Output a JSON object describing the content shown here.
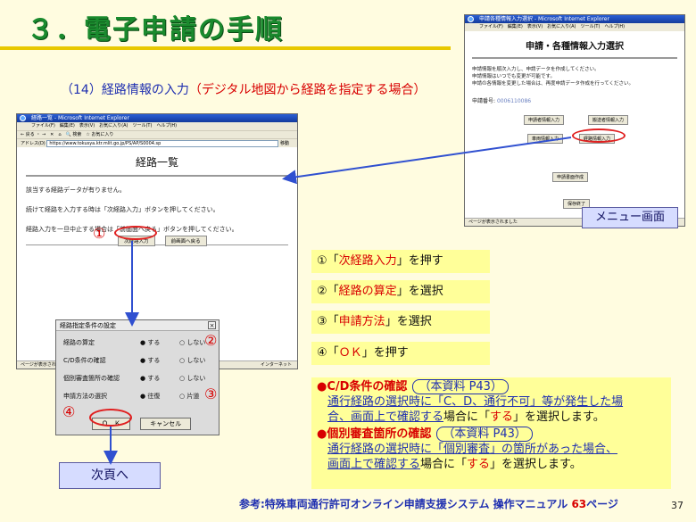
{
  "title": "３．電子申請の手順",
  "subtitle": {
    "main": "（14）経路情報の入力",
    "note": "（デジタル地図から経路を指定する場合）"
  },
  "route_window": {
    "title": "経路一覧 - Microsoft Internet Explorer",
    "menu": "ファイル(F)　編集(E)　表示(V)　お気に入り(A)　ツール(T)　ヘルプ(H)",
    "toolbar": "← 戻る ・ →　✕　⌂　🔍 検索　☆ お気に入り",
    "address_label": "アドレス(D)",
    "url": "https://www.tokusya.ktr.mlit.go.jp/PS/AP/S0004.sp",
    "go_label": "移動",
    "heading": "経路一覧",
    "lines": [
      "該当する経路データが有りません。",
      "続けて経路を入力する時は「次経路入力」ボタンを押してください。",
      "経路入力を一旦中止する場合は「前画面へ戻る」ボタンを押してください。"
    ],
    "buttons": {
      "next_route": "次経路入力",
      "back": "前画面へ戻る"
    },
    "status_left": "ページが表示されました",
    "status_right": "インターネット"
  },
  "dialog": {
    "title": "経路指定条件の設定",
    "rows": [
      {
        "label": "経路の算定",
        "yes": "● する",
        "no": "○ しない"
      },
      {
        "label": "C/D条件の確認",
        "yes": "● する",
        "no": "○ しない"
      },
      {
        "label": "個別審査箇所の確認",
        "yes": "● する",
        "no": "○ しない"
      },
      {
        "label": "申請方法の選択",
        "yes": "● 往復",
        "no": "○ 片道"
      }
    ],
    "ok": "Ｏ　Ｋ",
    "cancel": "キャンセル"
  },
  "menu_window": {
    "title": "申請各種情報入力選択 - Microsoft Internet Explorer",
    "menu": "ファイル(F)　編集(E)　表示(V)　お気に入り(A)　ツール(T)　ヘルプ(H)",
    "heading": "申請・各種情報入力選択",
    "lines": [
      "申請情報を順次入力し、申請データを作成してください。",
      "申請情報はいつでも変更が可能です。",
      "申請の各情報を変更した場合は、再度申請データ作成を行ってください。"
    ],
    "app_no_label": "申請番号:",
    "app_no_value": "0006110086",
    "buttons": {
      "applicant": "申請者情報入力",
      "transport": "搬送者情報入力",
      "vehicle": "車両情報入力",
      "route": "経路情報入力",
      "create": "申請書面作成",
      "exit": "保存終了"
    },
    "status": "ページが表示されました"
  },
  "menu_label": "メニュー画面",
  "markers": [
    "①",
    "②",
    "③",
    "④"
  ],
  "steps": [
    {
      "num": "①",
      "pre": "「",
      "item": "次経路入力",
      "post": "」を押す"
    },
    {
      "num": "②",
      "pre": "「",
      "item": "経路の算定",
      "post": "」を選択"
    },
    {
      "num": "③",
      "pre": "「",
      "item": "申請方法",
      "post": "」を選択"
    },
    {
      "num": "④",
      "pre": "「",
      "item": "ＯＫ",
      "post": "」を押す"
    }
  ],
  "info": {
    "cd_head": "●C/D条件の確認",
    "cd_ref": "（本資料 P43）",
    "cd_text_1": "通行経路の選択時に「C、D、通行不可」等が発生した場",
    "cd_text_2a": "合、画面上で確認する",
    "cd_text_2b": "場合に「",
    "cd_text_2c": "する",
    "cd_text_2d": "」を選択します。",
    "ind_head": "●個別審査箇所の確認",
    "ind_ref": "（本資料 P43）",
    "ind_text_1": "通行経路の選択時に「個別審査」の箇所があった場合、",
    "ind_text_2a": "画面上で確認する",
    "ind_text_2b": "場合に「",
    "ind_text_2c": "する",
    "ind_text_2d": "」を選択します。"
  },
  "next_page": "次頁へ",
  "reference": {
    "text": "参考:特殊車両通行許可オンライン申請支援システム 操作マニュアル ",
    "page": "63",
    "suffix": "ページ"
  },
  "page_number": "37"
}
